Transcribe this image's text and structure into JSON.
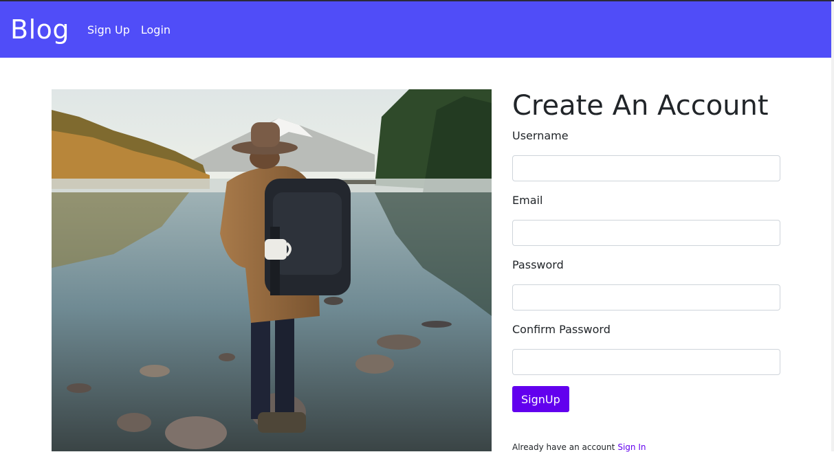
{
  "navbar": {
    "brand": "Blog",
    "links": [
      "Sign Up",
      "Login"
    ],
    "background": "#504df8"
  },
  "hero_image": {
    "icon": "hiker-at-lake-photo"
  },
  "form": {
    "title": "Create An Account",
    "fields": [
      {
        "label": "Username",
        "value": ""
      },
      {
        "label": "Email",
        "value": ""
      },
      {
        "label": "Password",
        "value": ""
      },
      {
        "label": "Confirm Password",
        "value": ""
      }
    ],
    "submit_label": "SignUp",
    "accent": "#6200ee",
    "footer_text": "Already have an account",
    "footer_link": "Sign In"
  }
}
